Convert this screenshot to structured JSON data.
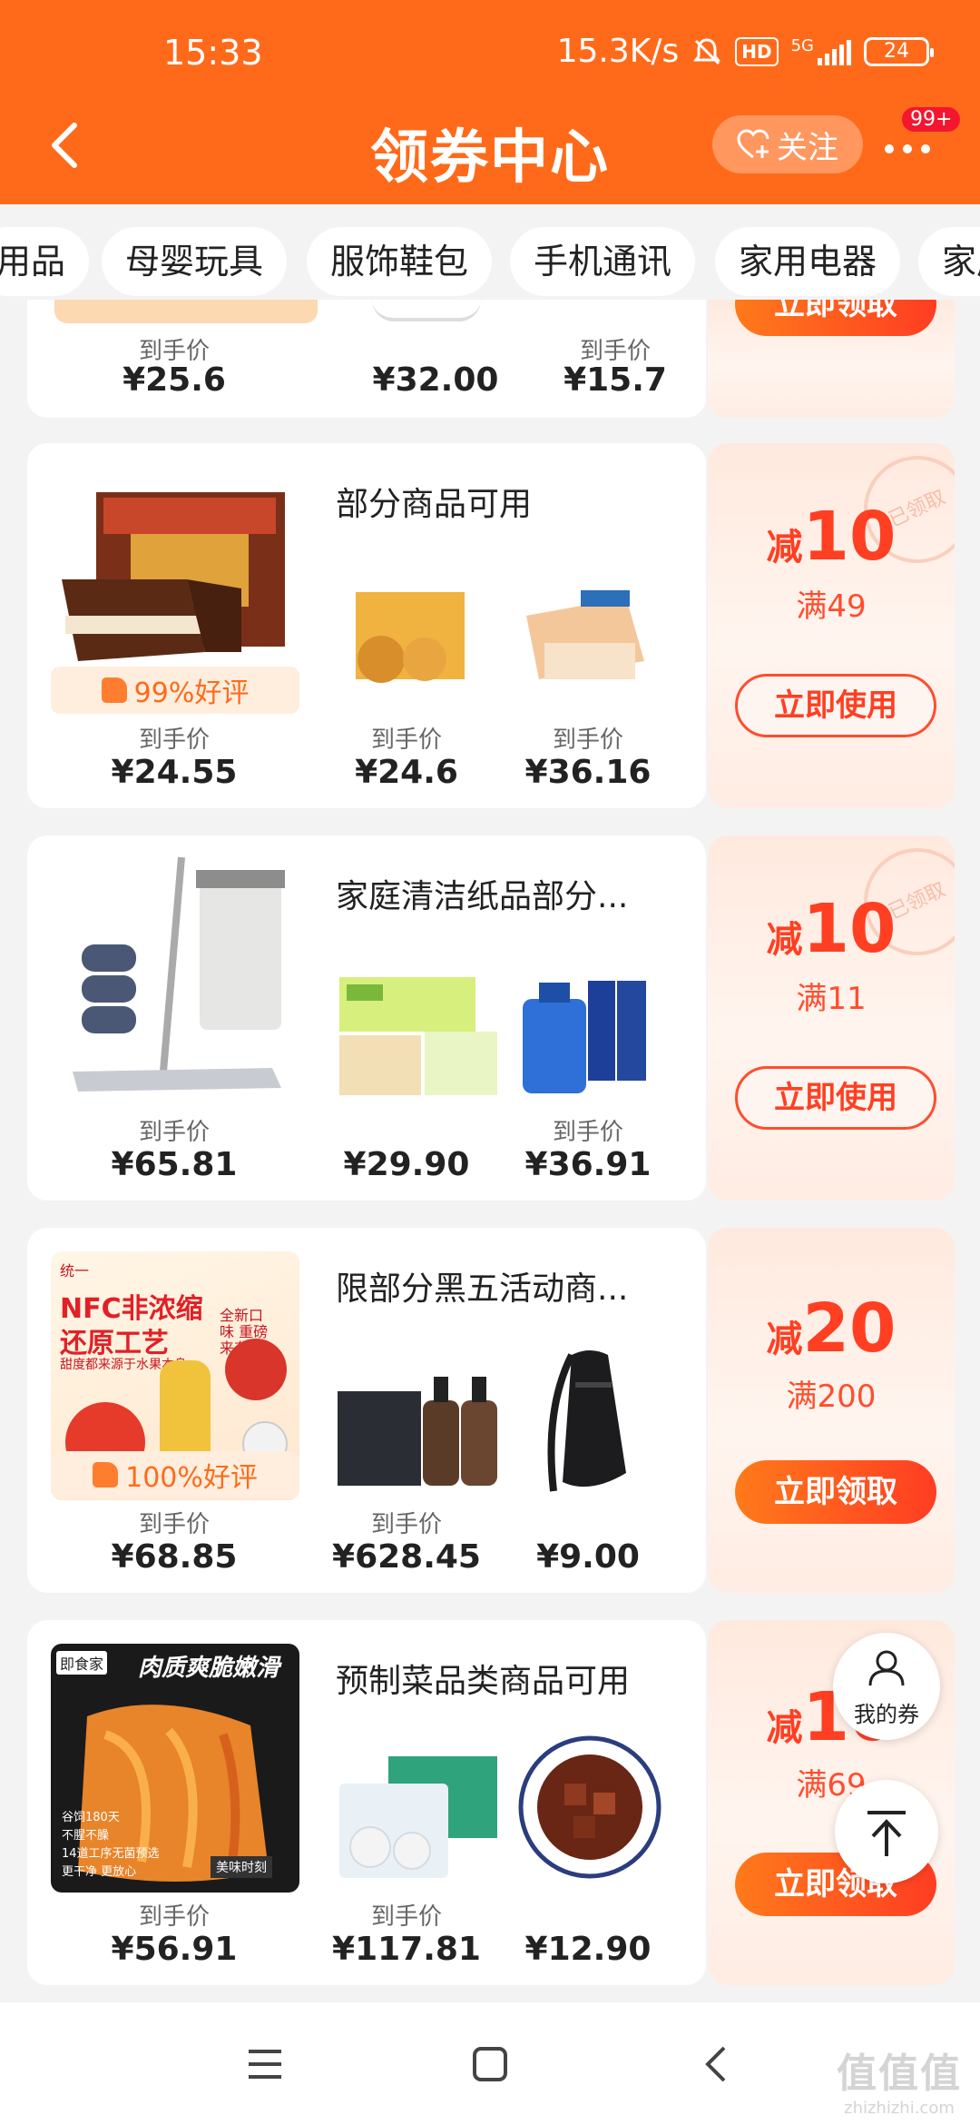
{
  "status_bar": {
    "time": "15:33",
    "net_speed": "15.3K/s",
    "hd": "HD",
    "net_type": "5G",
    "battery": "24"
  },
  "header": {
    "title": "领券中心",
    "follow_label": "关注",
    "badge": "99+"
  },
  "categories": [
    "用品",
    "母婴玩具",
    "服饰鞋包",
    "手机通讯",
    "家用电器",
    "家居"
  ],
  "coupon0": {
    "labels": [
      "到手价",
      "",
      "到手价"
    ],
    "prices": [
      "¥25.6",
      "¥32.00",
      "¥15.7"
    ],
    "action": "立即领取"
  },
  "coupon1": {
    "condition": "部分商品可用",
    "rating": "99%好评",
    "labels": [
      "到手价",
      "到手价",
      "到手价"
    ],
    "prices": [
      "¥24.55",
      "¥24.6",
      "¥36.16"
    ],
    "minus": "减",
    "amount": "10",
    "threshold": "满49",
    "action": "立即使用",
    "stamp": "已领取"
  },
  "coupon2": {
    "condition": "家庭清洁纸品部分...",
    "labels": [
      "到手价",
      "",
      "到手价"
    ],
    "prices": [
      "¥65.81",
      "¥29.90",
      "¥36.91"
    ],
    "minus": "减",
    "amount": "10",
    "threshold": "满11",
    "action": "立即使用",
    "stamp": "已领取"
  },
  "coupon3": {
    "condition": "限部分黑五活动商...",
    "rating": "100%好评",
    "labels": [
      "到手价",
      "到手价",
      ""
    ],
    "prices": [
      "¥68.85",
      "¥628.45",
      "¥9.00"
    ],
    "minus": "减",
    "amount": "20",
    "threshold": "满200",
    "action": "立即领取",
    "image_text": {
      "brand": "统一",
      "line1": "NFC非浓缩",
      "line2": "还原工艺",
      "line3": "甜度都来源于水果本身",
      "side": "全新口味 重磅来袭"
    }
  },
  "coupon4": {
    "condition": "预制菜品类商品可用",
    "labels": [
      "到手价",
      "到手价",
      ""
    ],
    "prices": [
      "¥56.91",
      "¥117.81",
      "¥12.90"
    ],
    "minus": "减",
    "amount": "10",
    "threshold": "满69",
    "action": "立即领取",
    "image_text": {
      "brand": "即食家",
      "headline": "肉质爽脆嫩滑",
      "bullets": [
        "谷饲180天",
        "不腥不臊",
        "14道工序无菌预选",
        "更干净 更放心"
      ],
      "tag": "美味时刻"
    }
  },
  "fab": {
    "mine_label": "我的券"
  },
  "watermark": {
    "cn": "值值值",
    "url": "zhizhizhi.com"
  },
  "colors": {
    "brand": "#ff6a1a",
    "accent": "#ff3f22"
  }
}
